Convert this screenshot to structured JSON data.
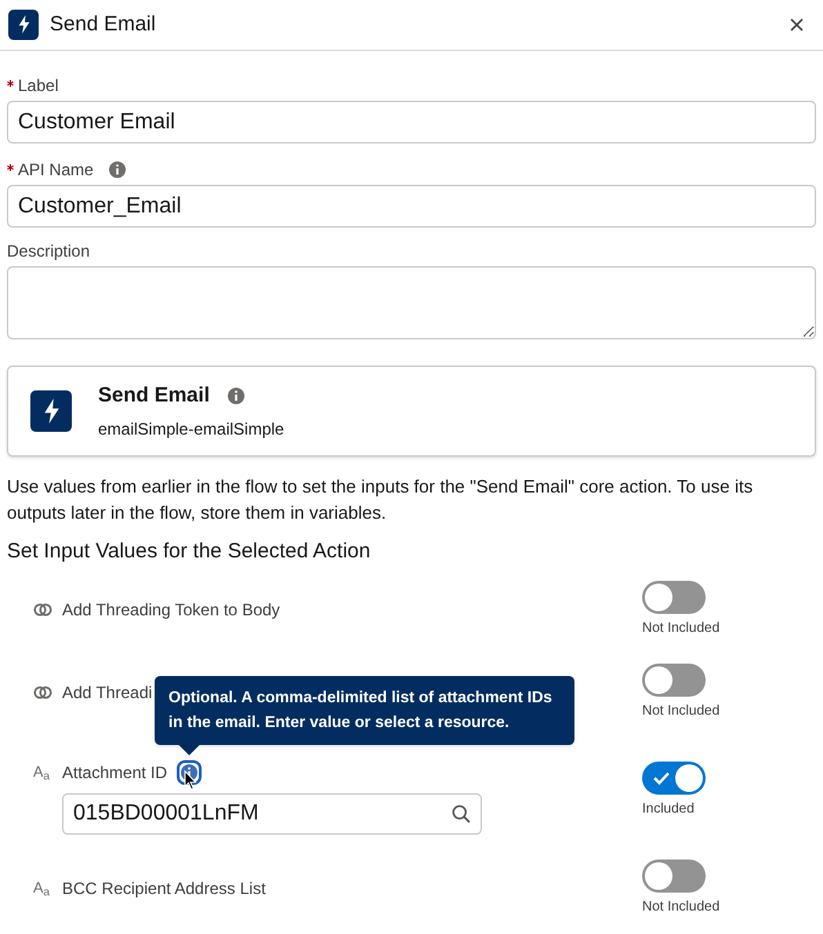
{
  "header": {
    "title": "Send Email"
  },
  "fields": [
    {
      "label": "Label",
      "required": true,
      "info": false,
      "value": "Customer Email"
    },
    {
      "label": "API Name",
      "required": true,
      "info": true,
      "value": "Customer_Email"
    }
  ],
  "description": {
    "label": "Description"
  },
  "action_card": {
    "title": "Send Email",
    "subtitle": "emailSimple-emailSimple"
  },
  "intro": "Use values from earlier in the flow to set the inputs for the \"Send Email\" core action. To use its outputs later in the flow, store them in variables.",
  "section_title": "Set Input Values for the Selected Action",
  "inputs": [
    {
      "kind": "boolean",
      "label": "Add Threading Token to Body",
      "on": false,
      "status": "Not Included"
    },
    {
      "kind": "boolean",
      "label": "Add Threadi",
      "on": false,
      "status": "Not Included"
    },
    {
      "kind": "text",
      "type_glyph": "A$_{a}$",
      "label": "Attachment ID",
      "on": true,
      "status": "Included",
      "value": "015BD00001LnFM",
      "tooltip": "Optional. A comma-delimited list of attachment IDs in the email. Enter value or select a resource."
    },
    {
      "kind": "text",
      "type_glyph": "A$_{a}$",
      "label": "BCC Recipient Address List",
      "on": false,
      "status": "Not Included"
    }
  ]
}
